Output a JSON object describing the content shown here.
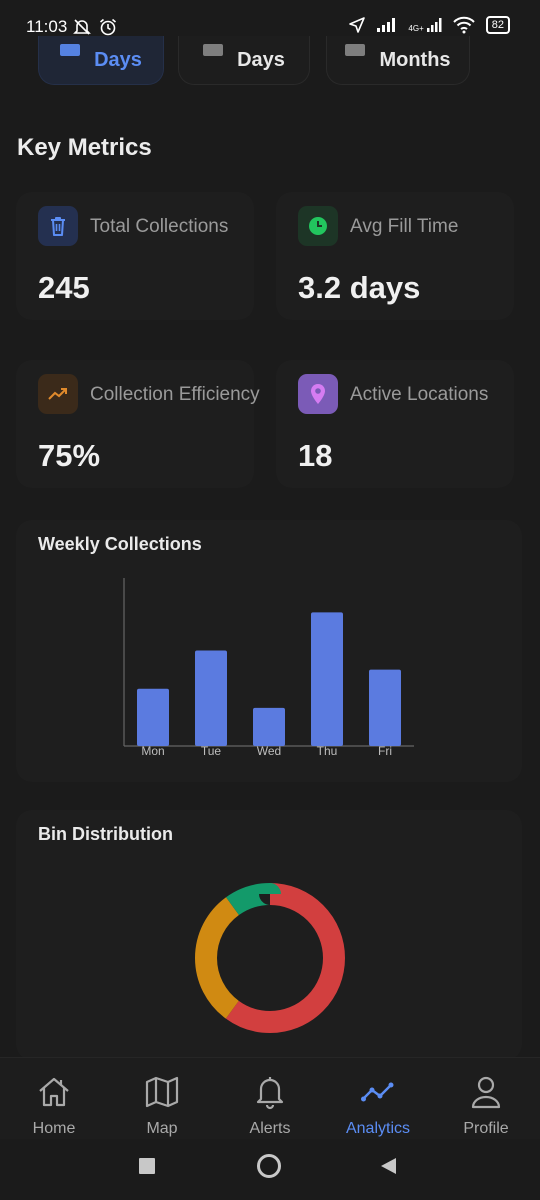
{
  "status_bar": {
    "time": "11:03",
    "network_label": "4G+",
    "battery": "82",
    "icons": [
      "mute-bell-icon",
      "alarm-icon",
      "location-arrow-icon",
      "signal-icon",
      "signal-4g-icon",
      "wifi-icon",
      "battery-icon"
    ]
  },
  "range_tabs": [
    {
      "label": "Days",
      "active": true,
      "icon": "keyboard-icon"
    },
    {
      "label": "Days",
      "active": false,
      "icon": "keyboard-icon"
    },
    {
      "label": "Months",
      "active": false,
      "icon": "keyboard-icon"
    }
  ],
  "section_title": "Key Metrics",
  "metrics": [
    {
      "label": "Total Collections",
      "value": "245",
      "icon": "trash-icon",
      "icon_color": "#5b8df4",
      "icon_bg": "#243050"
    },
    {
      "label": "Avg Fill Time",
      "value": "3.2 days",
      "icon": "clock-icon",
      "icon_color": "#22c55e",
      "icon_bg": "#1d3526"
    },
    {
      "label": "Collection Efficiency",
      "value": "75%",
      "icon": "trend-up-icon",
      "icon_color": "#e08a2c",
      "icon_bg": "#3b2a1a"
    },
    {
      "label": "Active Locations",
      "value": "18",
      "icon": "map-pin-icon",
      "icon_color": "#c974f0",
      "icon_bg": "#7b5bb7"
    }
  ],
  "weekly_chart": {
    "title": "Weekly Collections",
    "color": "#5b7be0"
  },
  "distribution_chart": {
    "title": "Bin Distribution"
  },
  "chart_data": [
    {
      "type": "bar",
      "categories": [
        "Mon",
        "Tue",
        "Wed",
        "Thu",
        "Fri"
      ],
      "values": [
        30,
        50,
        20,
        70,
        40
      ],
      "title": "Weekly Collections",
      "xlabel": "",
      "ylabel": "",
      "ylim": [
        0,
        88
      ],
      "grid": false
    },
    {
      "type": "pie",
      "donut": true,
      "slices": [
        {
          "value": 60,
          "color": "#d23f3f"
        },
        {
          "value": 30,
          "color": "#d08a12"
        },
        {
          "value": 10,
          "color": "#139a6a"
        }
      ],
      "title": "Bin Distribution"
    }
  ],
  "nav": {
    "items": [
      {
        "label": "Home",
        "icon": "home-icon",
        "active": false
      },
      {
        "label": "Map",
        "icon": "map-icon",
        "active": false
      },
      {
        "label": "Alerts",
        "icon": "bell-icon",
        "active": false
      },
      {
        "label": "Analytics",
        "icon": "analytics-icon",
        "active": true
      },
      {
        "label": "Profile",
        "icon": "profile-icon",
        "active": false
      }
    ],
    "active_color": "#5b8df4"
  },
  "system_nav": [
    "recent-apps-icon",
    "home-circle-icon",
    "back-icon"
  ]
}
